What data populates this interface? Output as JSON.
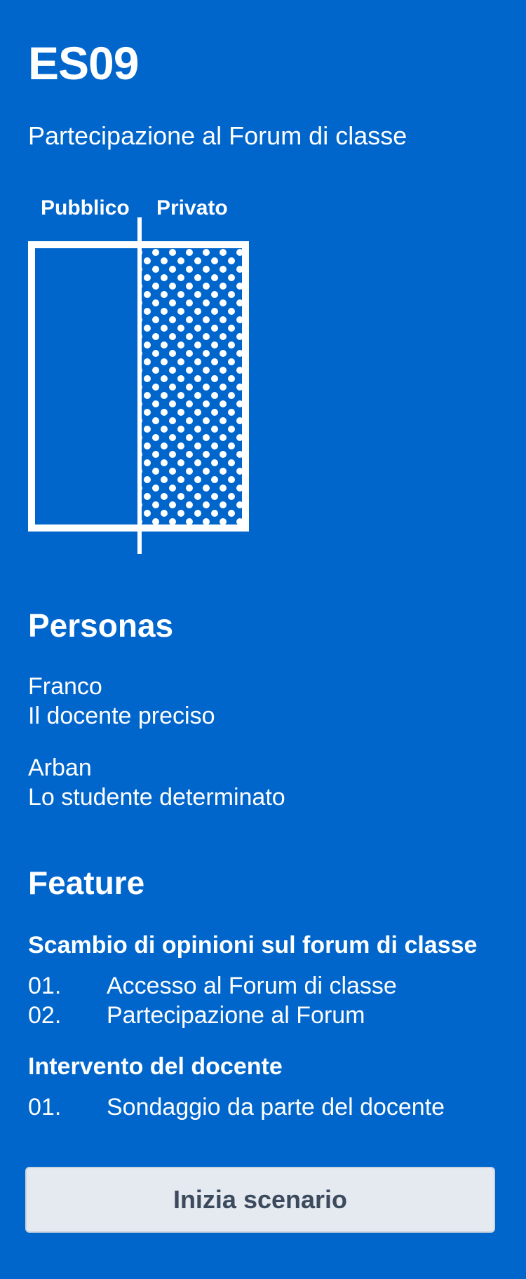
{
  "header": {
    "code": "ES09",
    "subtitle": "Partecipazione al Forum di classe"
  },
  "diagram": {
    "public_label": "Pubblico",
    "private_label": "Privato"
  },
  "personas": {
    "title": "Personas",
    "items": [
      {
        "name": "Franco",
        "role": "Il docente preciso"
      },
      {
        "name": "Arban",
        "role": "Lo studente determinato"
      }
    ]
  },
  "features": {
    "title": "Feature",
    "groups": [
      {
        "title": "Scambio di opinioni sul forum di classe",
        "items": [
          {
            "num": "01.",
            "label": "Accesso al Forum di classe"
          },
          {
            "num": "02.",
            "label": "Partecipazione al Forum"
          }
        ]
      },
      {
        "title": "Intervento del docente",
        "items": [
          {
            "num": "01.",
            "label": "Sondaggio da parte del docente"
          }
        ]
      }
    ]
  },
  "cta": {
    "label": "Inizia scenario"
  },
  "colors": {
    "background": "#0066cc",
    "text": "#ffffff",
    "button_background": "#e5e9f0",
    "button_text": "#3b4a5c"
  }
}
